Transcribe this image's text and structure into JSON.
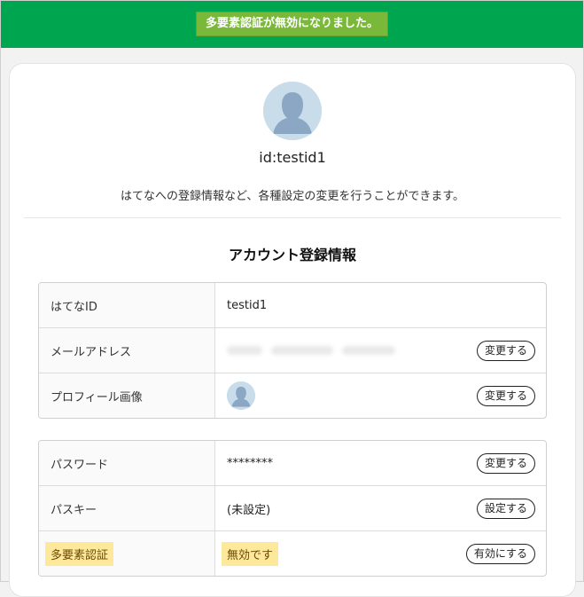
{
  "banner": {
    "message": "多要素認証が無効になりました。"
  },
  "profile": {
    "user_id": "id:testid1",
    "description": "はてなへの登録情報など、各種設定の変更を行うことができます。"
  },
  "section": {
    "title": "アカウント登録情報"
  },
  "account_table": {
    "rows": [
      {
        "label": "はてなID",
        "value": "testid1"
      },
      {
        "label": "メールアドレス",
        "value": "",
        "button": "変更する"
      },
      {
        "label": "プロフィール画像",
        "value": "",
        "button": "変更する"
      }
    ]
  },
  "security_table": {
    "rows": [
      {
        "label": "パスワード",
        "value": "********",
        "button": "変更する"
      },
      {
        "label": "パスキー",
        "value": "(未設定)",
        "button": "設定する"
      },
      {
        "label": "多要素認証",
        "value": "無効です",
        "button": "有効にする"
      }
    ]
  },
  "colors": {
    "banner": "#00a54f",
    "banner_message_bg": "#7ab83a",
    "highlight": "#fde89b"
  }
}
